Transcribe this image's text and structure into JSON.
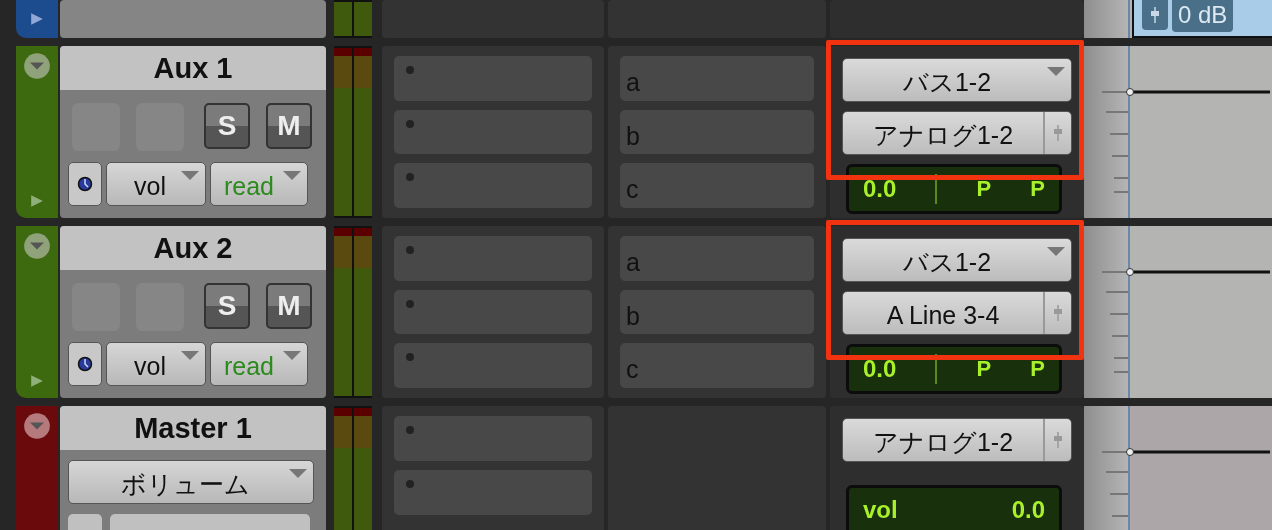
{
  "tracks": [
    {
      "kind": "partial",
      "color": "#1d4c8e",
      "clip_label": "0 dB"
    },
    {
      "kind": "aux",
      "color": "#3d6a0e",
      "name": "Aux 1",
      "solo": "S",
      "mute": "M",
      "view": "vol",
      "automation": "read",
      "sends": [
        "a",
        "b",
        "c"
      ],
      "output": "バス1-2",
      "input": "アナログ1-2",
      "volume": "0.0",
      "pan_left": "P",
      "pan_right": "P",
      "highlighted": true
    },
    {
      "kind": "aux",
      "color": "#3d6a0e",
      "name": "Aux 2",
      "solo": "S",
      "mute": "M",
      "view": "vol",
      "automation": "read",
      "sends": [
        "a",
        "b",
        "c"
      ],
      "output": "バス1-2",
      "input": "A Line 3-4",
      "volume": "0.0",
      "pan_left": "P",
      "pan_right": "P",
      "highlighted": true
    },
    {
      "kind": "master",
      "color": "#6a0a0c",
      "name": "Master 1",
      "view": "ボリューム",
      "input": "アナログ1-2",
      "volume_label": "vol",
      "volume": "0.0"
    }
  ]
}
